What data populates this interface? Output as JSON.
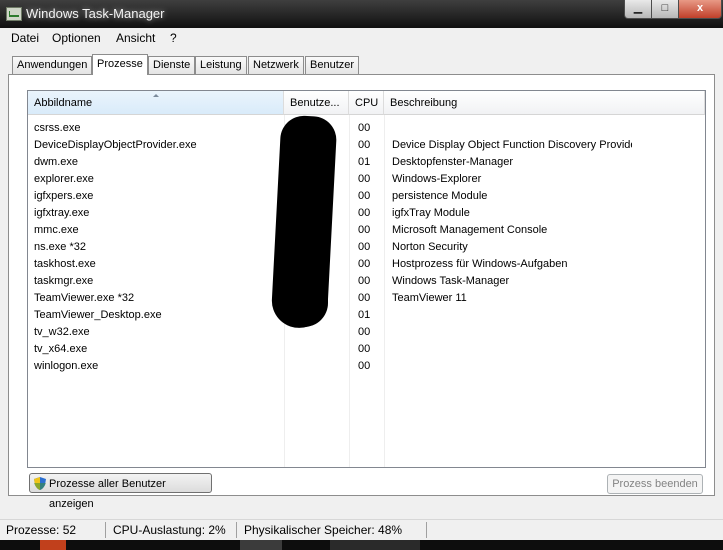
{
  "window": {
    "title": "Windows Task-Manager",
    "controls": {
      "minimize": "▁",
      "maximize": "□",
      "close": "x"
    }
  },
  "menu": [
    "Datei",
    "Optionen",
    "Ansicht",
    "?"
  ],
  "tabs": [
    {
      "label": "Anwendungen",
      "active": false
    },
    {
      "label": "Prozesse",
      "active": true
    },
    {
      "label": "Dienste",
      "active": false
    },
    {
      "label": "Leistung",
      "active": false
    },
    {
      "label": "Netzwerk",
      "active": false
    },
    {
      "label": "Benutzer",
      "active": false
    }
  ],
  "table": {
    "columns": [
      "Abbildname",
      "Benutze...",
      "CPU",
      "Beschreibung"
    ],
    "sorted_column": "Abbildname",
    "rows": [
      {
        "name": "csrss.exe",
        "user": "",
        "cpu": "00",
        "desc": ""
      },
      {
        "name": "DeviceDisplayObjectProvider.exe",
        "user": "",
        "cpu": "00",
        "desc": "Device Display Object Function Discovery Provider"
      },
      {
        "name": "dwm.exe",
        "user": "",
        "cpu": "01",
        "desc": "Desktopfenster-Manager"
      },
      {
        "name": "explorer.exe",
        "user": "",
        "cpu": "00",
        "desc": "Windows-Explorer"
      },
      {
        "name": "igfxpers.exe",
        "user": "",
        "cpu": "00",
        "desc": "persistence Module"
      },
      {
        "name": "igfxtray.exe",
        "user": "",
        "cpu": "00",
        "desc": "igfxTray Module"
      },
      {
        "name": "mmc.exe",
        "user": "",
        "cpu": "00",
        "desc": "Microsoft Management Console"
      },
      {
        "name": "ns.exe *32",
        "user": "",
        "cpu": "00",
        "desc": "Norton Security"
      },
      {
        "name": "taskhost.exe",
        "user": "",
        "cpu": "00",
        "desc": "Hostprozess für Windows-Aufgaben"
      },
      {
        "name": "taskmgr.exe",
        "user": "",
        "cpu": "00",
        "desc": "Windows Task-Manager"
      },
      {
        "name": "TeamViewer.exe *32",
        "user": "",
        "cpu": "00",
        "desc": "TeamViewer 11"
      },
      {
        "name": "TeamViewer_Desktop.exe",
        "user": "",
        "cpu": "01",
        "desc": ""
      },
      {
        "name": "tv_w32.exe",
        "user": "",
        "cpu": "00",
        "desc": ""
      },
      {
        "name": "tv_x64.exe",
        "user": "",
        "cpu": "00",
        "desc": ""
      },
      {
        "name": "winlogon.exe",
        "user": "",
        "cpu": "00",
        "desc": ""
      }
    ]
  },
  "buttons": {
    "show_all": "Prozesse aller Benutzer anzeigen",
    "end_process": "Prozess beenden"
  },
  "status": {
    "processes": "Prozesse: 52",
    "cpu": "CPU-Auslastung: 2%",
    "memory": "Physikalischer Speicher: 48%"
  },
  "colors": {
    "titlebar": "#1a1a1a",
    "window_bg": "#f0f0f0",
    "header_sorted": "#d9ebfa",
    "disabled_text": "#838383"
  }
}
